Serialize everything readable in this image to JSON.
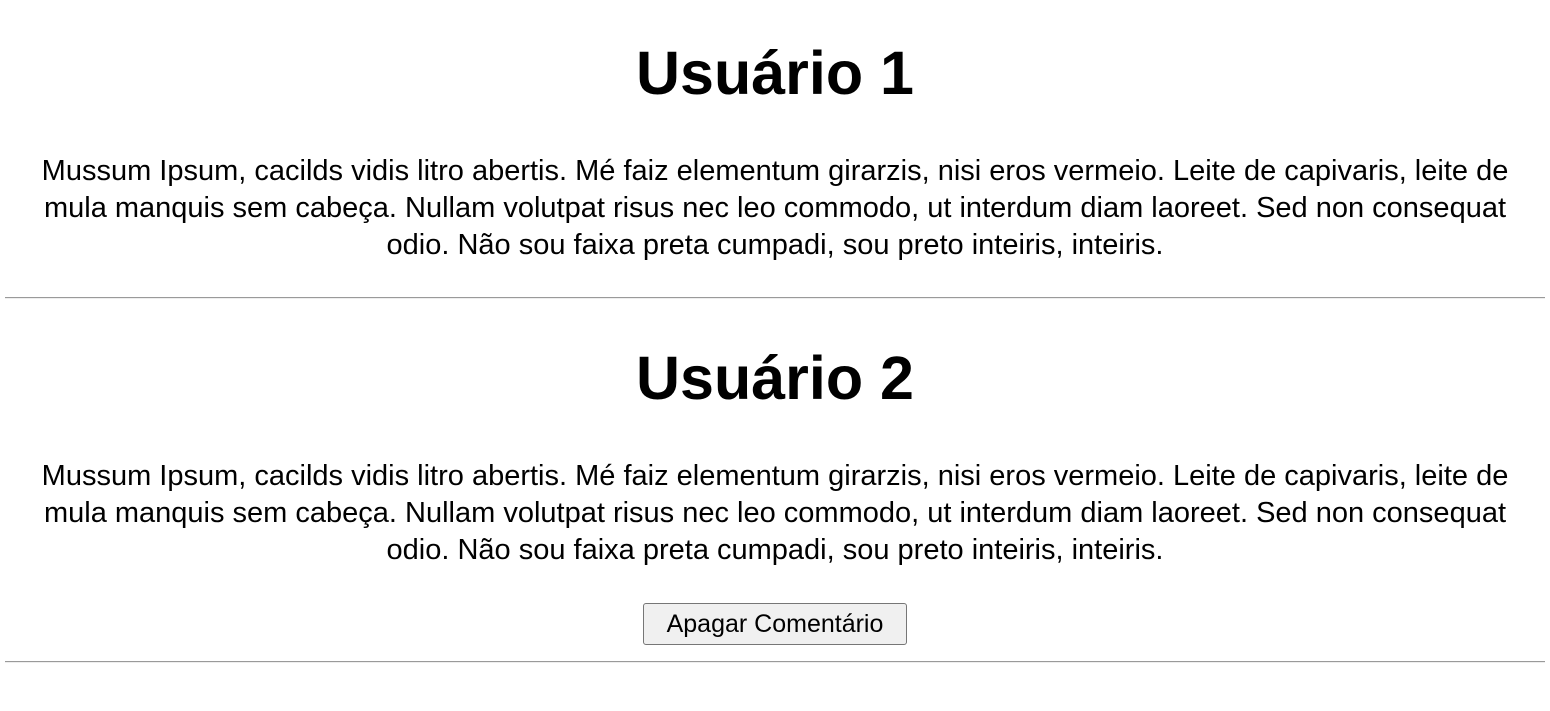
{
  "comments": [
    {
      "title": "Usuário 1",
      "body": "Mussum Ipsum, cacilds vidis litro abertis. Mé faiz elementum girarzis, nisi eros vermeio. Leite de capivaris, leite de mula manquis sem cabeça. Nullam volutpat risus nec leo commodo, ut interdum diam laoreet. Sed non consequat odio. Não sou faixa preta cumpadi, sou preto inteiris, inteiris."
    },
    {
      "title": "Usuário 2",
      "body": "Mussum Ipsum, cacilds vidis litro abertis. Mé faiz elementum girarzis, nisi eros vermeio. Leite de capivaris, leite de mula manquis sem cabeça. Nullam volutpat risus nec leo commodo, ut interdum diam laoreet. Sed non consequat odio. Não sou faixa preta cumpadi, sou preto inteiris, inteiris.",
      "delete_label": "Apagar Comentário"
    }
  ],
  "colors": {
    "button_bg": "#f0f0f0",
    "button_border": "#767676",
    "divider": "#9a9a9a"
  }
}
